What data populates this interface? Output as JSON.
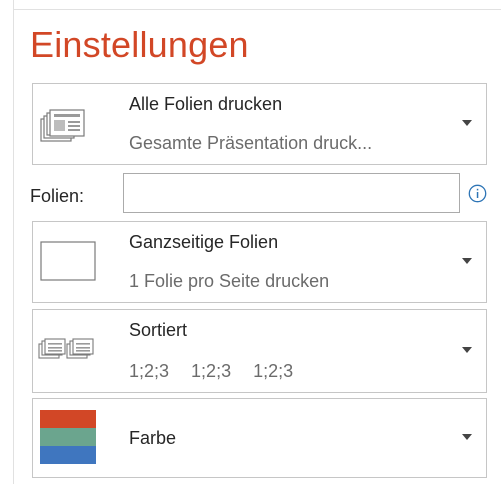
{
  "settings": {
    "title": "Einstellungen",
    "print_range": {
      "title": "Alle Folien drucken",
      "subtitle": "Gesamte Präsentation druck..."
    },
    "slides_field": {
      "label": "Folien:",
      "value": "",
      "info_icon": "info-icon"
    },
    "layout": {
      "title": "Ganzseitige Folien",
      "subtitle": "1 Folie pro Seite drucken"
    },
    "collation": {
      "title": "Sortiert",
      "sequences": [
        "1;2;3",
        "1;2;3",
        "1;2;3"
      ]
    },
    "color": {
      "title": "Farbe",
      "swatch_colors": [
        "#d24726",
        "#6ba58e",
        "#3f76bf"
      ]
    },
    "colors": {
      "accent": "#d24726",
      "info": "#2e75b6"
    }
  }
}
